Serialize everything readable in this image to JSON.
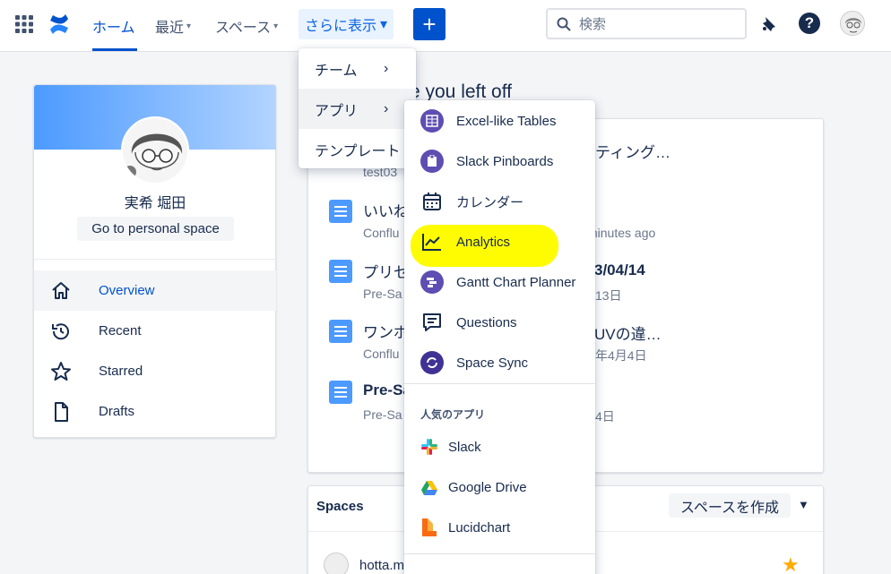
{
  "topnav": {
    "home": "ホーム",
    "recent": "最近",
    "spaces": "スペース",
    "more": "さらに表示",
    "create": "+",
    "search_placeholder": "検索"
  },
  "more_menu": {
    "teams": "チーム",
    "apps": "アプリ",
    "templates": "テンプレート"
  },
  "apps_menu": {
    "items": [
      {
        "label": "Excel-like Tables",
        "icon": "table-icon"
      },
      {
        "label": "Slack Pinboards",
        "icon": "pinboard-icon"
      },
      {
        "label": "カレンダー",
        "icon": "calendar-icon"
      },
      {
        "label": "Analytics",
        "icon": "analytics-icon"
      },
      {
        "label": "Gantt Chart Planner",
        "icon": "gantt-icon"
      },
      {
        "label": "Questions",
        "icon": "questions-icon"
      },
      {
        "label": "Space Sync",
        "icon": "sync-icon"
      }
    ],
    "popular_heading": "人気のアプリ",
    "popular": [
      {
        "label": "Slack",
        "icon": "slack-icon"
      },
      {
        "label": "Google Drive",
        "icon": "google-drive-icon"
      },
      {
        "label": "Lucidchart",
        "icon": "lucidchart-icon"
      }
    ],
    "highlight_color": "#fffb00"
  },
  "profile": {
    "name": "実希 堀田",
    "personal_space": "Go to personal space"
  },
  "sidebar": {
    "items": [
      {
        "label": "Overview",
        "icon": "home-icon",
        "active": true
      },
      {
        "label": "Recent",
        "icon": "history-icon"
      },
      {
        "label": "Starred",
        "icon": "star-icon"
      },
      {
        "label": "Drafts",
        "icon": "draft-icon"
      }
    ]
  },
  "main": {
    "heading": "re you left off",
    "recent": [
      {
        "title": "ティング…",
        "meta": "test03"
      },
      {
        "title": "いいね",
        "meta_left": "Conflu",
        "meta_right": "minutes ago"
      },
      {
        "title": "プリセ",
        "title_right": "3/04/14",
        "meta_left": "Pre-Sa",
        "meta_right": "13日"
      },
      {
        "title": "ワンポ",
        "title_right": "UVの違…",
        "meta_left": "Conflu",
        "meta_right": "年4月4日"
      },
      {
        "title": "Pre-Sa",
        "meta_left": "Pre-Sa",
        "meta_right": "4日"
      }
    ]
  },
  "spaces": {
    "title": "Spaces",
    "create": "スペースを作成",
    "first_item": "hotta.m"
  },
  "colors": {
    "primary": "#0052cc",
    "app_icon": "#5e4db2",
    "doc_icon": "#4c9aff",
    "star": "#ffab00"
  }
}
